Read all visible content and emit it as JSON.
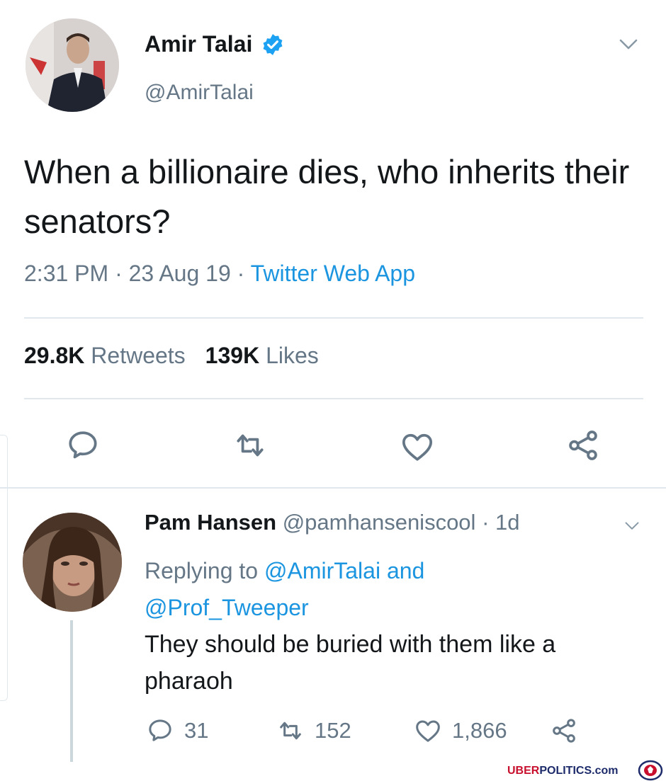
{
  "tweet": {
    "author": {
      "name": "Amir Talai",
      "handle": "@AmirTalai"
    },
    "text": "When a billionaire dies, who inherits their senators?",
    "meta": {
      "time": "2:31 PM",
      "separator": "·",
      "date": "23 Aug 19",
      "source": "Twitter Web App"
    },
    "stats": {
      "retweets_count": "29.8K",
      "retweets_label": "Retweets",
      "likes_count": "139K",
      "likes_label": "Likes"
    }
  },
  "reply": {
    "author": {
      "name": "Pam Hansen",
      "handle": "@pamhanseniscool"
    },
    "age": "· 1d",
    "replying_prefix": "Replying to",
    "mention_1": "@AmirTalai",
    "conjunction": "and",
    "mention_2": "@Prof_Tweeper",
    "text": "They should be buried with them like a pharaoh",
    "counts": {
      "replies": "31",
      "retweets": "152",
      "likes": "1,866"
    }
  },
  "watermark": {
    "brand_part1": "UBER",
    "brand_part2": "POLITICS.com"
  },
  "colors": {
    "link": "#1b95e0",
    "secondary": "#657786",
    "verified": "#1da1f2",
    "divider": "#e1e8ed",
    "watermark_red": "#c8102e",
    "watermark_navy": "#1d2b6b"
  },
  "icons": [
    "verified-icon",
    "chevron-down-icon",
    "reply-icon",
    "retweet-icon",
    "like-icon",
    "share-icon"
  ]
}
